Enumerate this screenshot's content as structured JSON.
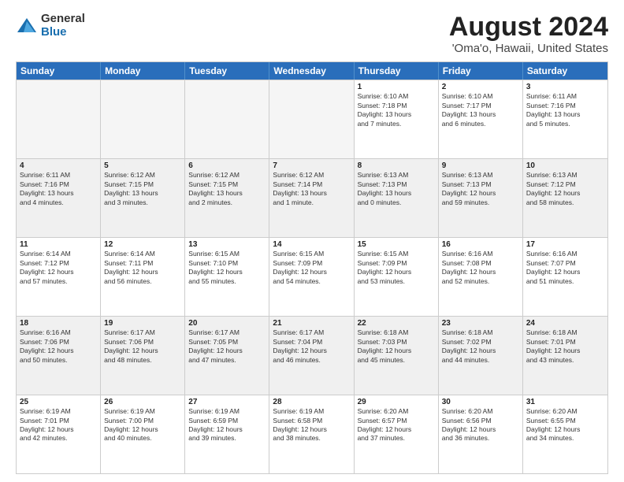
{
  "logo": {
    "general": "General",
    "blue": "Blue"
  },
  "title": "August 2024",
  "subtitle": "'Oma'o, Hawaii, United States",
  "days": [
    "Sunday",
    "Monday",
    "Tuesday",
    "Wednesday",
    "Thursday",
    "Friday",
    "Saturday"
  ],
  "rows": [
    [
      {
        "day": "",
        "lines": [],
        "empty": true
      },
      {
        "day": "",
        "lines": [],
        "empty": true
      },
      {
        "day": "",
        "lines": [],
        "empty": true
      },
      {
        "day": "",
        "lines": [],
        "empty": true
      },
      {
        "day": "1",
        "lines": [
          "Sunrise: 6:10 AM",
          "Sunset: 7:18 PM",
          "Daylight: 13 hours",
          "and 7 minutes."
        ]
      },
      {
        "day": "2",
        "lines": [
          "Sunrise: 6:10 AM",
          "Sunset: 7:17 PM",
          "Daylight: 13 hours",
          "and 6 minutes."
        ]
      },
      {
        "day": "3",
        "lines": [
          "Sunrise: 6:11 AM",
          "Sunset: 7:16 PM",
          "Daylight: 13 hours",
          "and 5 minutes."
        ]
      }
    ],
    [
      {
        "day": "4",
        "lines": [
          "Sunrise: 6:11 AM",
          "Sunset: 7:16 PM",
          "Daylight: 13 hours",
          "and 4 minutes."
        ]
      },
      {
        "day": "5",
        "lines": [
          "Sunrise: 6:12 AM",
          "Sunset: 7:15 PM",
          "Daylight: 13 hours",
          "and 3 minutes."
        ]
      },
      {
        "day": "6",
        "lines": [
          "Sunrise: 6:12 AM",
          "Sunset: 7:15 PM",
          "Daylight: 13 hours",
          "and 2 minutes."
        ]
      },
      {
        "day": "7",
        "lines": [
          "Sunrise: 6:12 AM",
          "Sunset: 7:14 PM",
          "Daylight: 13 hours",
          "and 1 minute."
        ]
      },
      {
        "day": "8",
        "lines": [
          "Sunrise: 6:13 AM",
          "Sunset: 7:13 PM",
          "Daylight: 13 hours",
          "and 0 minutes."
        ]
      },
      {
        "day": "9",
        "lines": [
          "Sunrise: 6:13 AM",
          "Sunset: 7:13 PM",
          "Daylight: 12 hours",
          "and 59 minutes."
        ]
      },
      {
        "day": "10",
        "lines": [
          "Sunrise: 6:13 AM",
          "Sunset: 7:12 PM",
          "Daylight: 12 hours",
          "and 58 minutes."
        ]
      }
    ],
    [
      {
        "day": "11",
        "lines": [
          "Sunrise: 6:14 AM",
          "Sunset: 7:12 PM",
          "Daylight: 12 hours",
          "and 57 minutes."
        ]
      },
      {
        "day": "12",
        "lines": [
          "Sunrise: 6:14 AM",
          "Sunset: 7:11 PM",
          "Daylight: 12 hours",
          "and 56 minutes."
        ]
      },
      {
        "day": "13",
        "lines": [
          "Sunrise: 6:15 AM",
          "Sunset: 7:10 PM",
          "Daylight: 12 hours",
          "and 55 minutes."
        ]
      },
      {
        "day": "14",
        "lines": [
          "Sunrise: 6:15 AM",
          "Sunset: 7:09 PM",
          "Daylight: 12 hours",
          "and 54 minutes."
        ]
      },
      {
        "day": "15",
        "lines": [
          "Sunrise: 6:15 AM",
          "Sunset: 7:09 PM",
          "Daylight: 12 hours",
          "and 53 minutes."
        ]
      },
      {
        "day": "16",
        "lines": [
          "Sunrise: 6:16 AM",
          "Sunset: 7:08 PM",
          "Daylight: 12 hours",
          "and 52 minutes."
        ]
      },
      {
        "day": "17",
        "lines": [
          "Sunrise: 6:16 AM",
          "Sunset: 7:07 PM",
          "Daylight: 12 hours",
          "and 51 minutes."
        ]
      }
    ],
    [
      {
        "day": "18",
        "lines": [
          "Sunrise: 6:16 AM",
          "Sunset: 7:06 PM",
          "Daylight: 12 hours",
          "and 50 minutes."
        ]
      },
      {
        "day": "19",
        "lines": [
          "Sunrise: 6:17 AM",
          "Sunset: 7:06 PM",
          "Daylight: 12 hours",
          "and 48 minutes."
        ]
      },
      {
        "day": "20",
        "lines": [
          "Sunrise: 6:17 AM",
          "Sunset: 7:05 PM",
          "Daylight: 12 hours",
          "and 47 minutes."
        ]
      },
      {
        "day": "21",
        "lines": [
          "Sunrise: 6:17 AM",
          "Sunset: 7:04 PM",
          "Daylight: 12 hours",
          "and 46 minutes."
        ]
      },
      {
        "day": "22",
        "lines": [
          "Sunrise: 6:18 AM",
          "Sunset: 7:03 PM",
          "Daylight: 12 hours",
          "and 45 minutes."
        ]
      },
      {
        "day": "23",
        "lines": [
          "Sunrise: 6:18 AM",
          "Sunset: 7:02 PM",
          "Daylight: 12 hours",
          "and 44 minutes."
        ]
      },
      {
        "day": "24",
        "lines": [
          "Sunrise: 6:18 AM",
          "Sunset: 7:01 PM",
          "Daylight: 12 hours",
          "and 43 minutes."
        ]
      }
    ],
    [
      {
        "day": "25",
        "lines": [
          "Sunrise: 6:19 AM",
          "Sunset: 7:01 PM",
          "Daylight: 12 hours",
          "and 42 minutes."
        ]
      },
      {
        "day": "26",
        "lines": [
          "Sunrise: 6:19 AM",
          "Sunset: 7:00 PM",
          "Daylight: 12 hours",
          "and 40 minutes."
        ]
      },
      {
        "day": "27",
        "lines": [
          "Sunrise: 6:19 AM",
          "Sunset: 6:59 PM",
          "Daylight: 12 hours",
          "and 39 minutes."
        ]
      },
      {
        "day": "28",
        "lines": [
          "Sunrise: 6:19 AM",
          "Sunset: 6:58 PM",
          "Daylight: 12 hours",
          "and 38 minutes."
        ]
      },
      {
        "day": "29",
        "lines": [
          "Sunrise: 6:20 AM",
          "Sunset: 6:57 PM",
          "Daylight: 12 hours",
          "and 37 minutes."
        ]
      },
      {
        "day": "30",
        "lines": [
          "Sunrise: 6:20 AM",
          "Sunset: 6:56 PM",
          "Daylight: 12 hours",
          "and 36 minutes."
        ]
      },
      {
        "day": "31",
        "lines": [
          "Sunrise: 6:20 AM",
          "Sunset: 6:55 PM",
          "Daylight: 12 hours",
          "and 34 minutes."
        ]
      }
    ]
  ]
}
